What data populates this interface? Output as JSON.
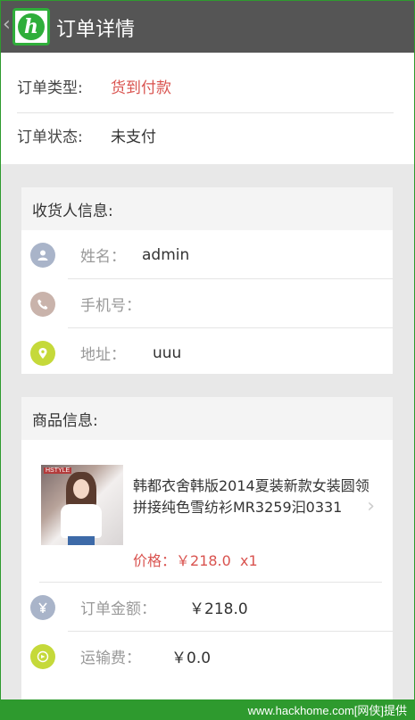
{
  "header": {
    "back_icon": "chevron-left-icon",
    "logo_letter": "h",
    "title": "订单详情"
  },
  "order": {
    "type_label": "订单类型:",
    "type_value": "货到付款",
    "status_label": "订单状态:",
    "status_value": "未支付"
  },
  "receiver": {
    "section_title": "收货人信息:",
    "rows": [
      {
        "icon": "person-icon",
        "label": "姓名：",
        "value": "admin"
      },
      {
        "icon": "phone-icon",
        "label": "手机号：",
        "value": ""
      },
      {
        "icon": "location-pin-icon",
        "label": "地址：",
        "value": "uuu"
      }
    ]
  },
  "goods": {
    "section_title": "商品信息:",
    "product": {
      "thumb_tag": "HSTYLE",
      "title": "韩都衣舍韩版2014夏装新款女装圆领拼接纯色雪纺衫MR3259汩0331",
      "price_label": "价格：",
      "price": "￥218.0",
      "quantity": "x1"
    },
    "rows": [
      {
        "icon": "yen-icon",
        "label": "订单金额：",
        "value": "￥218.0"
      },
      {
        "icon": "shipping-icon",
        "label": "运输费：",
        "value": "￥0.0"
      }
    ]
  },
  "footer": {
    "text": "www.hackhome.com[网侠]提供"
  },
  "colors": {
    "topbar": "#555555",
    "accent_red": "#d9534f",
    "brand_green": "#2fae3a",
    "person_icon": "#a9b4c9",
    "phone_icon": "#c9b3ab",
    "pin_icon": "#c5d93a",
    "yen_icon": "#a9b4c9",
    "shipping_icon": "#c5d93a"
  }
}
